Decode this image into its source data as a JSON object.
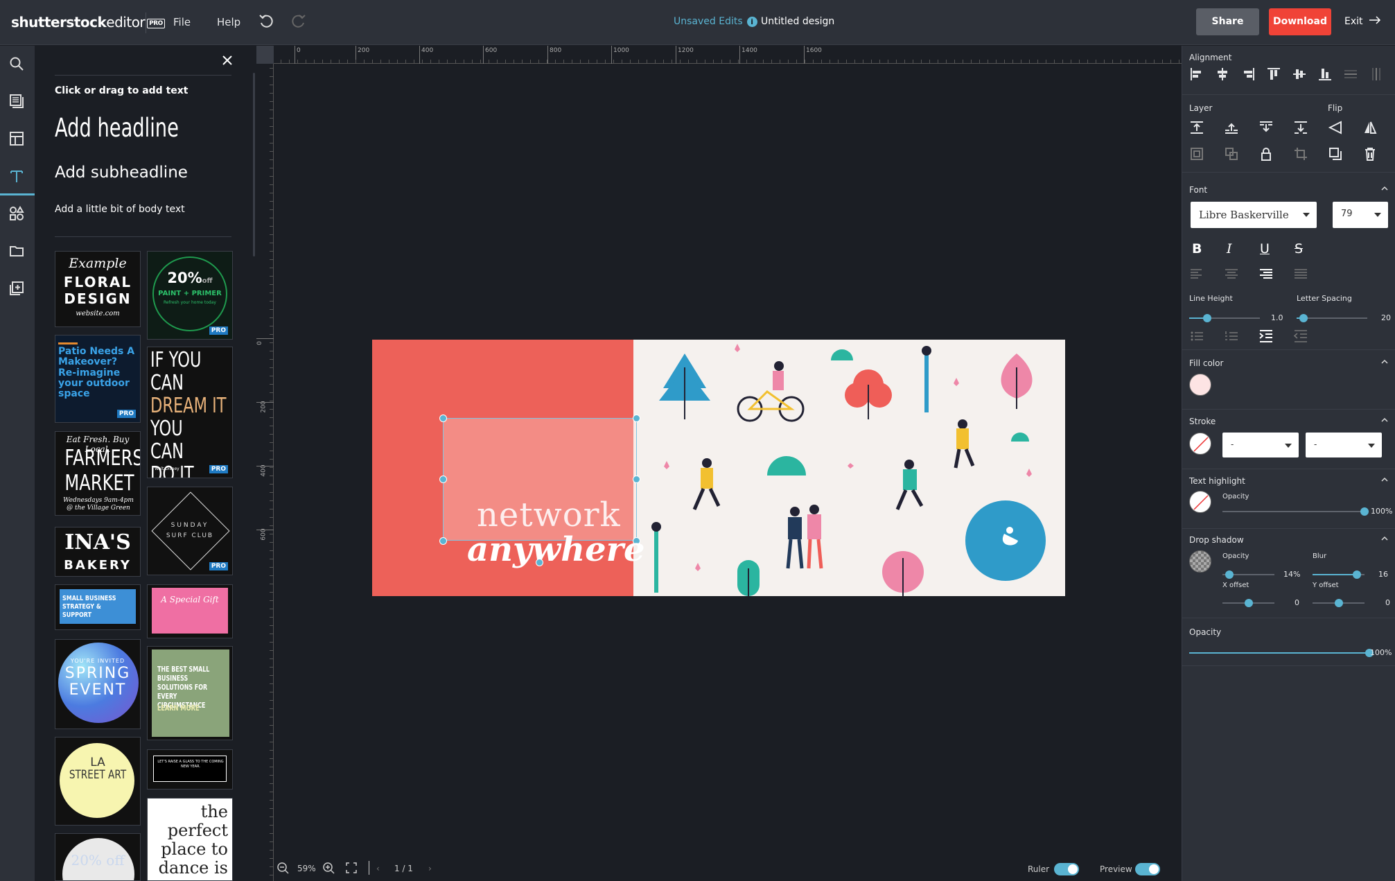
{
  "header": {
    "brand_main": "shutterstock",
    "brand_sub": "editor",
    "brand_pro": "PRO",
    "menu_file": "File",
    "menu_help": "Help",
    "unsaved": "Unsaved Edits",
    "unsaved_info": "i",
    "design_title": "Untitled design",
    "share": "Share",
    "download": "Download",
    "exit": "Exit"
  },
  "panel": {
    "hint": "Click or drag to add text",
    "add_headline": "Add headline",
    "add_subheadline": "Add subheadline",
    "add_body": "Add a little bit of body text",
    "pro_badge": "PRO",
    "templates": {
      "floral_1": "Example",
      "floral_2": "FLORAL",
      "floral_3": "DESIGN",
      "floral_4": "website.com",
      "paint_1": "20%",
      "paint_2": "off",
      "paint_3": "PAINT + PRIMER",
      "paint_4": "Refresh your home today",
      "patio_1": "Patio Needs A Makeover?",
      "patio_2": "Re-imagine your outdoor space",
      "dream_1": "IF YOU CAN",
      "dream_2": "DREAM IT",
      "dream_3": "YOU CAN DO IT",
      "dream_4": "- Walt Disney",
      "farm_1": "Eat Fresh. Buy Local.",
      "farm_2": "FARMERS",
      "farm_3": "MARKET",
      "farm_4": "Wednesdays 9am-4pm @ the Village Green",
      "surf_1": "SUNDAY",
      "surf_2": "SURF CLUB",
      "ina_1": "INA'S",
      "ina_2": "BAKERY",
      "biz_1": "SMALL BUSINESS STRATEGY & SUPPORT",
      "gift_1": "A Special Gift",
      "spring_0": "YOU'RE INVITED",
      "spring_1": "SPRING",
      "spring_2": "EVENT",
      "best_1": "THE BEST SMALL BUSINESS SOLUTIONS FOR EVERY CIRCUMSTANCE",
      "best_2": "LEARN MORE",
      "glass_1": "LET'S RAISE A GLASS TO THE COMING NEW YEAR.",
      "la_1": "LA",
      "la_2": "STREET ART",
      "perfect_1": "the perfect place to dance is",
      "twenty": "20% off"
    }
  },
  "ruler": {
    "h_ticks": [
      "0",
      "200",
      "400",
      "600",
      "800",
      "1000",
      "1200",
      "1400",
      "1600"
    ],
    "v_ticks": [
      "0",
      "200",
      "400",
      "600"
    ]
  },
  "design": {
    "line1": "network",
    "line2": "anywhere"
  },
  "bottom": {
    "zoom": "59%",
    "pages": "1 / 1",
    "ruler": "Ruler",
    "preview": "Preview"
  },
  "props": {
    "alignment": "Alignment",
    "layer": "Layer",
    "flip": "Flip",
    "font": "Font",
    "font_family": "Libre Baskerville",
    "font_size": "79",
    "line_height": "Line Height",
    "line_height_val": "1.0",
    "line_height_frac": 0.25,
    "letter_spacing": "Letter Spacing",
    "letter_spacing_val": "20",
    "letter_spacing_frac": 0.1,
    "fill_color": "Fill color",
    "fill_hex": "#fde4e4",
    "stroke": "Stroke",
    "stroke_opt1": "-",
    "stroke_opt2": "-",
    "highlight": "Text highlight",
    "hl_opacity": "Opacity",
    "hl_opacity_val": "100%",
    "shadow": "Drop shadow",
    "sh_opacity": "Opacity",
    "sh_opacity_val": "14%",
    "blur": "Blur",
    "blur_val": "16",
    "x_offset": "X offset",
    "x_offset_val": "0",
    "y_offset": "Y offset",
    "y_offset_val": "0",
    "opacity": "Opacity",
    "opacity_val": "100%"
  },
  "colors": {
    "accent": "#5ab4d2",
    "download": "#f04337",
    "coral": "#ed6159"
  }
}
